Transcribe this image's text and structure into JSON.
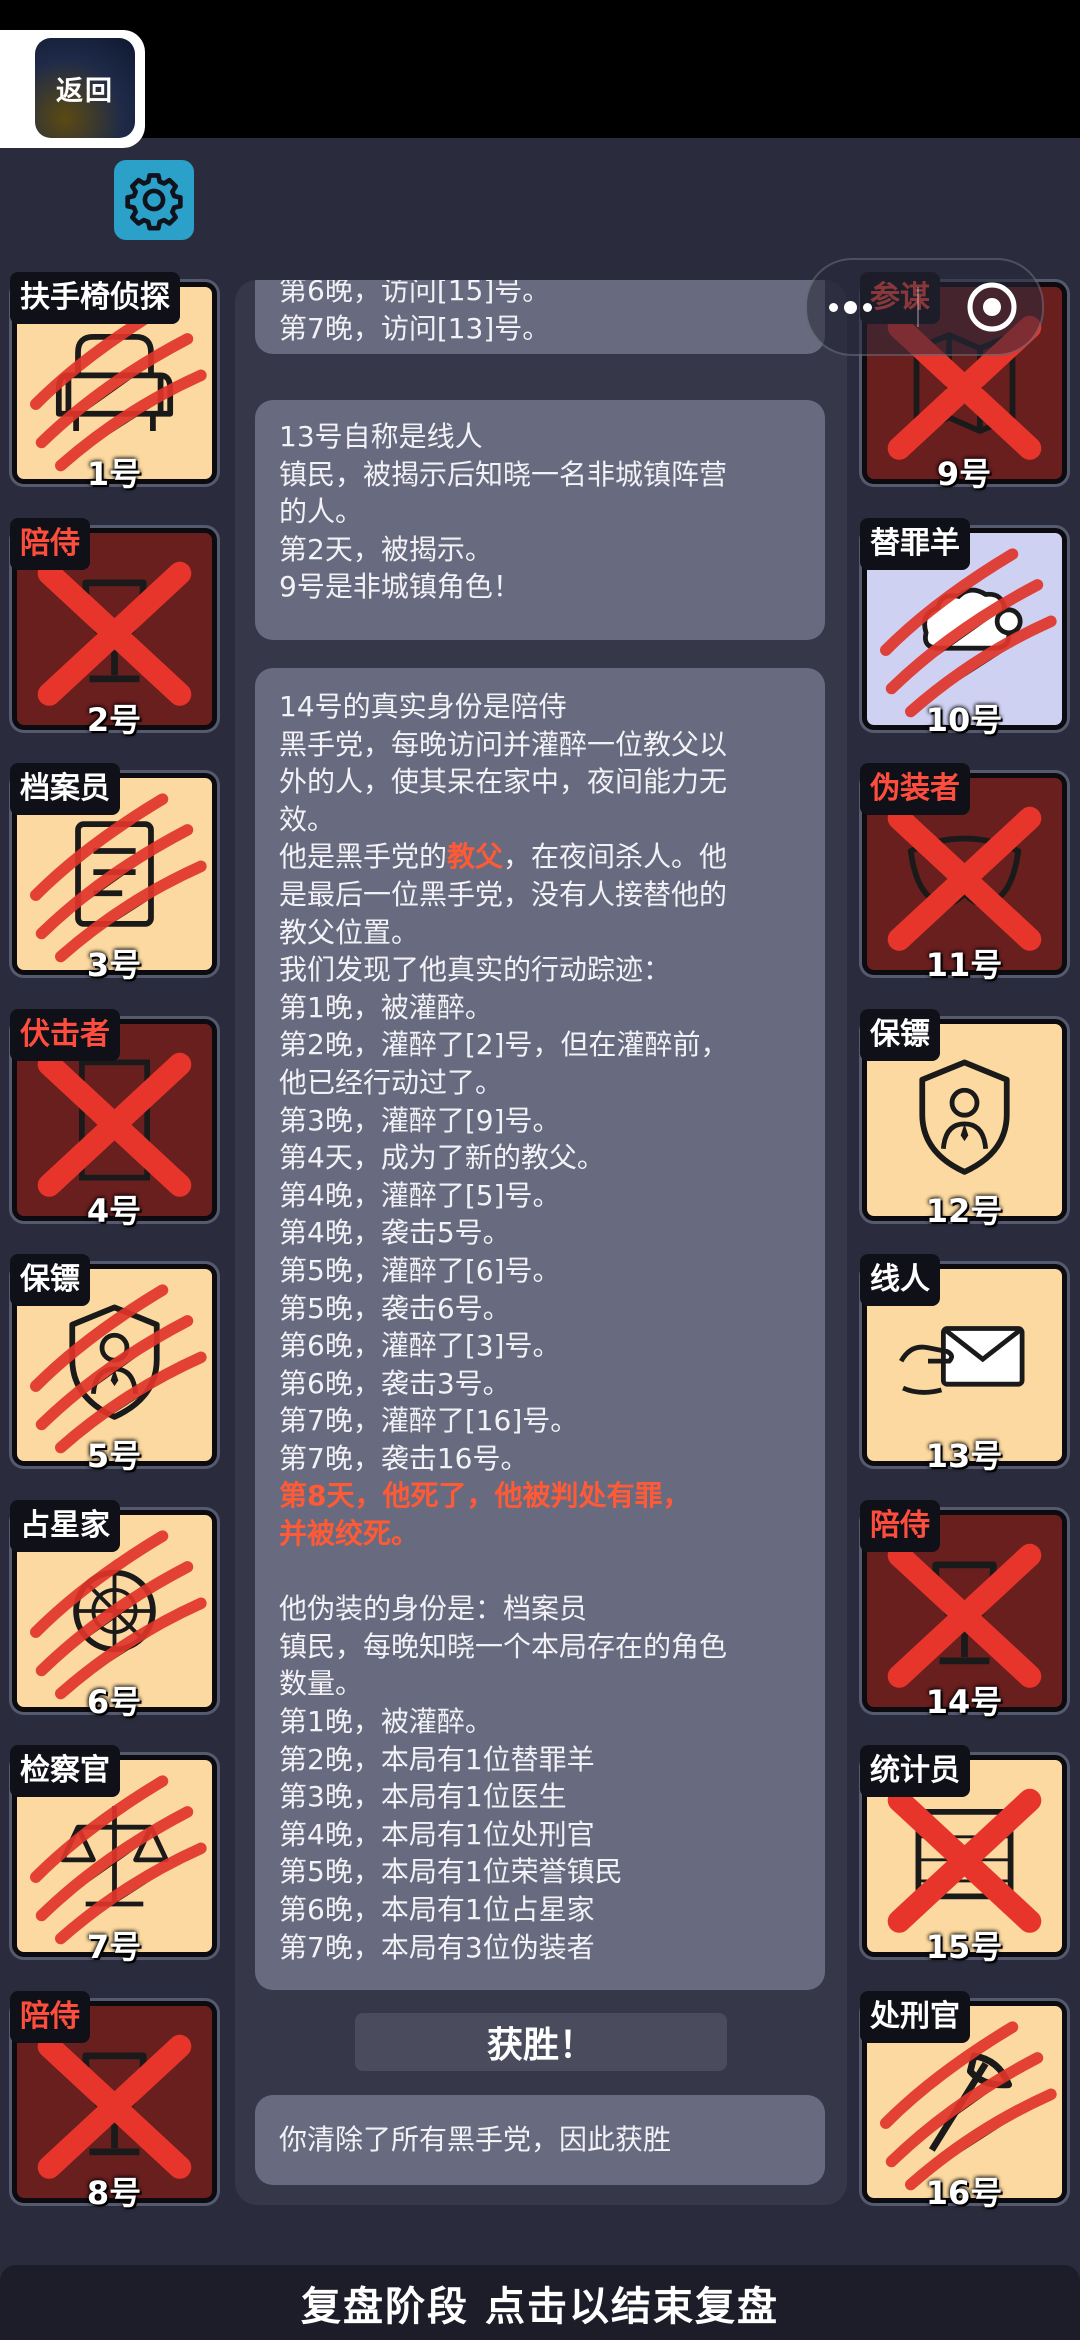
{
  "nav": {
    "back_label": "返回"
  },
  "center": {
    "msg1": [
      "第6晚，访问[15]号。",
      "第7晚，访问[13]号。"
    ],
    "msg2": [
      "13号自称是线人",
      "镇民，被揭示后知晓一名非城镇阵营",
      "的人。",
      "第2天，被揭示。",
      "9号是非城镇角色！"
    ],
    "msg3": {
      "l1": "14号的真实身份是陪侍",
      "l2": "黑手党，每晚访问并灌醉一位教父以",
      "l3": "外的人，使其呆在家中，夜间能力无",
      "l4": "效。",
      "l5a": "他是黑手党的",
      "l5b": "教父",
      "l5c": "，在夜间杀人。他",
      "l6": "是最后一位黑手党，没有人接替他的",
      "l7": "教父位置。",
      "l8": "我们发现了他真实的行动踪迹：",
      "actions": [
        "第1晚，被灌醉。",
        "第2晚，灌醉了[2]号，但在灌醉前，",
        "他已经行动过了。",
        "第3晚，灌醉了[9]号。",
        "第4天，成为了新的教父。",
        "第4晚，灌醉了[5]号。",
        "第4晚，袭击5号。",
        "第5晚，灌醉了[6]号。",
        "第5晚，袭击6号。",
        "第6晚，灌醉了[3]号。",
        "第6晚，袭击3号。",
        "第7晚，灌醉了[16]号。",
        "第7晚，袭击16号。"
      ],
      "death1": "第8天，他死了，他被判处有罪，",
      "death2": "并被绞死。",
      "disguise": [
        "他伪装的身份是：档案员",
        "镇民，每晚知晓一个本局存在的角色",
        "数量。",
        "第1晚，被灌醉。",
        "第2晚，本局有1位替罪羊",
        "第3晚，本局有1位医生",
        "第4晚，本局有1位处刑官",
        "第5晚，本局有1位荣誉镇民",
        "第6晚，本局有1位占星家",
        "第7晚，本局有3位伪装者"
      ]
    },
    "victory_label": "获胜！",
    "result_text": "你清除了所有黑手党，因此获胜"
  },
  "bottom_bar": "复盘阶段 点击以结束复盘",
  "players_left": [
    {
      "role": "扶手椅侦探",
      "num": "1号",
      "role_color": "#ffffff",
      "status": "attacked",
      "icon": "armchair-icon"
    },
    {
      "role": "陪侍",
      "num": "2号",
      "role_color": "#ff4d3d",
      "status": "dead",
      "icon": "wine-glass-icon"
    },
    {
      "role": "档案员",
      "num": "3号",
      "role_color": "#ffffff",
      "status": "attacked",
      "icon": "document-icon"
    },
    {
      "role": "伏击者",
      "num": "4号",
      "role_color": "#ff4d3d",
      "status": "dead",
      "icon": "door-icon"
    },
    {
      "role": "保镖",
      "num": "5号",
      "role_color": "#ffffff",
      "status": "attacked",
      "icon": "shield-person-icon"
    },
    {
      "role": "占星家",
      "num": "6号",
      "role_color": "#ffffff",
      "status": "attacked",
      "icon": "astrolabe-icon"
    },
    {
      "role": "检察官",
      "num": "7号",
      "role_color": "#ffffff",
      "status": "attacked",
      "icon": "scales-icon"
    },
    {
      "role": "陪侍",
      "num": "8号",
      "role_color": "#ff4d3d",
      "status": "dead",
      "icon": "wine-glass-icon"
    }
  ],
  "players_right": [
    {
      "role": "参谋",
      "num": "9号",
      "role_color": "#ff4d3d",
      "status": "dead",
      "icon": "map-icon"
    },
    {
      "role": "替罪羊",
      "num": "10号",
      "role_color": "#ffffff",
      "status": "attacked",
      "icon": "sheep-icon"
    },
    {
      "role": "伪装者",
      "num": "11号",
      "role_color": "#ff4d3d",
      "status": "dead",
      "icon": "mask-icon"
    },
    {
      "role": "保镖",
      "num": "12号",
      "role_color": "#ffffff",
      "status": "alive",
      "icon": "shield-person-icon"
    },
    {
      "role": "线人",
      "num": "13号",
      "role_color": "#ffffff",
      "status": "alive",
      "icon": "envelope-icon"
    },
    {
      "role": "陪侍",
      "num": "14号",
      "role_color": "#ff4d3d",
      "status": "dead",
      "icon": "wine-glass-icon"
    },
    {
      "role": "统计员",
      "num": "15号",
      "role_color": "#ffffff",
      "status": "attacked-crossed",
      "icon": "abacus-icon"
    },
    {
      "role": "处刑官",
      "num": "16号",
      "role_color": "#ffffff",
      "status": "attacked",
      "icon": "axe-icon"
    }
  ]
}
